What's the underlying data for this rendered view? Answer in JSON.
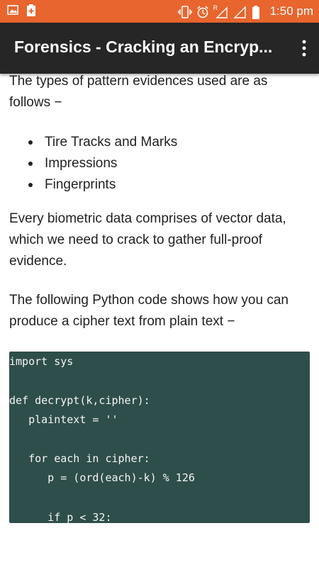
{
  "status_bar": {
    "time": "1:50 pm",
    "icons": [
      "image-icon",
      "battery-saver-icon",
      "vibrate-icon",
      "alarm-icon",
      "wifi-icon",
      "signal-icon",
      "battery-icon"
    ],
    "roaming_label": "R"
  },
  "app_bar": {
    "title": "Forensics - Cracking an Encryp...",
    "menu_icon": "more-vert-icon"
  },
  "content": {
    "intro": "The types of pattern evidences used are as follows −",
    "bullets": [
      "Tire Tracks and Marks",
      "Impressions",
      "Fingerprints"
    ],
    "paragraph2": "Every biometric data comprises of vector data, which we need to crack to gather full-proof evidence.",
    "paragraph3": "The following Python code shows how you can produce a cipher text from plain text −",
    "code_lines": [
      "import sys",
      "def decrypt(k,cipher):",
      "   plaintext = ''",
      "   for each in cipher:",
      "      p = (ord(each)-k) % 126",
      "      if p < 32:"
    ]
  },
  "colors": {
    "status_bar": "#e8652e",
    "app_bar": "#262626",
    "code_background": "#2e4e4b"
  }
}
